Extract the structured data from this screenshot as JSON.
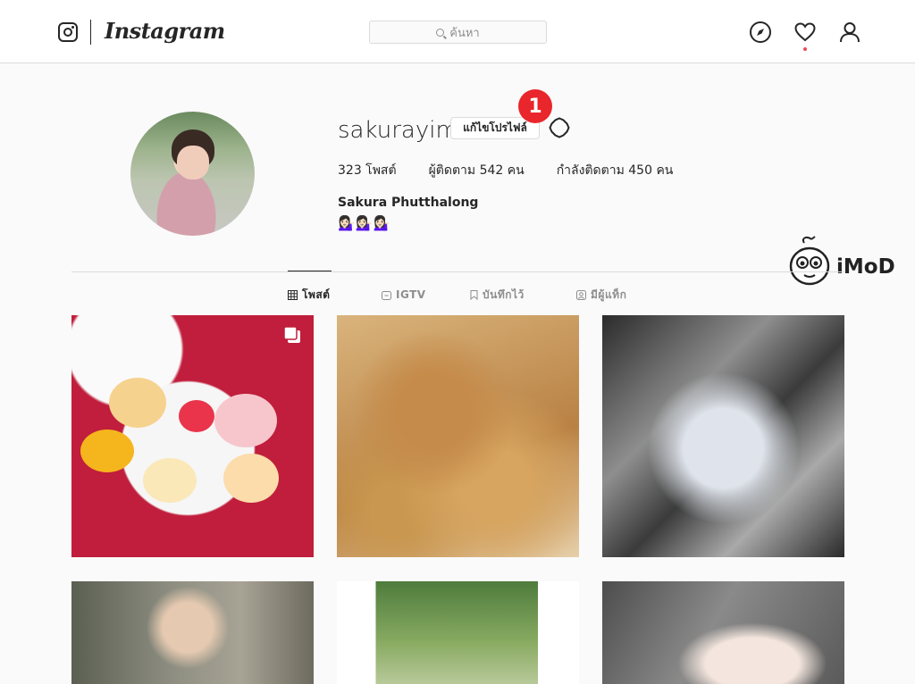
{
  "header": {
    "brand": "Instagram",
    "search_placeholder": "ค้นหา",
    "icons": [
      "instagram-glyph-icon",
      "compass-icon",
      "heart-icon",
      "profile-icon"
    ]
  },
  "profile": {
    "username": "sakurayim",
    "edit_button_label": "แก้ไขโปรไฟล์",
    "step_badge": "1",
    "stats": {
      "posts": "323 โพสต์",
      "followers": "ผู้ติดตาม 542 คน",
      "following": "กำลังติดตาม 450 คน"
    },
    "full_name": "Sakura Phutthalong",
    "bio": "💁🏻‍♀️💁🏻‍♀️💁🏻‍♀️"
  },
  "watermark": {
    "text": "iMoD"
  },
  "tabs": [
    {
      "label": "โพสต์",
      "icon": "grid-icon",
      "active": true
    },
    {
      "label": "IGTV",
      "icon": "igtv-icon",
      "active": false
    },
    {
      "label": "บันทึกไว้",
      "icon": "bookmark-icon",
      "active": false
    },
    {
      "label": "มีผู้แท็ก",
      "icon": "tagged-icon",
      "active": false
    }
  ],
  "colors": {
    "accent_red": "#e8262b",
    "notification_dot": "#ed4956",
    "border": "#dbdbdb",
    "text_primary": "#262626",
    "text_secondary": "#8e8e8e"
  }
}
